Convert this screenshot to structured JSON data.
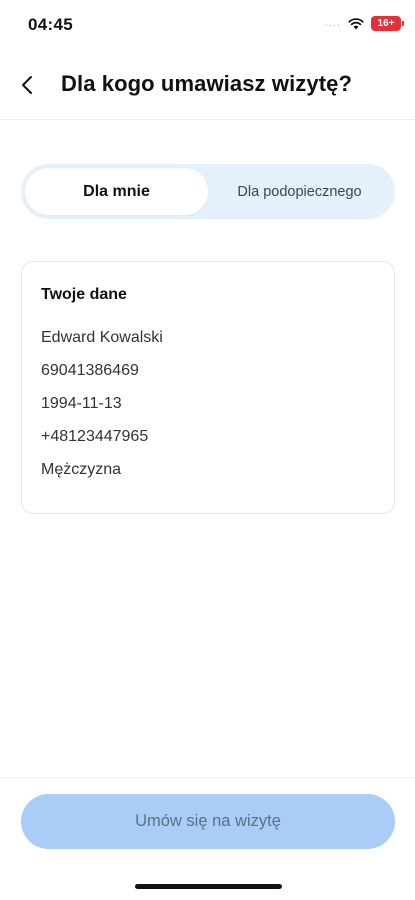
{
  "status_bar": {
    "time": "04:45",
    "signal": "....",
    "battery": "16+",
    "battery_color": "#e4303b"
  },
  "header": {
    "back_icon": "chevron-left-icon",
    "title": "Dla kogo umawiasz wizytę?"
  },
  "segments": {
    "selected": "Dla mnie",
    "options": [
      "Dla mnie",
      "Dla podopiecznego"
    ]
  },
  "card": {
    "title": "Twoje dane",
    "lines": [
      "Edward Kowalski",
      "69041386469",
      "1994-11-13",
      "+48123447965",
      "Mężczyzna"
    ]
  },
  "footer": {
    "button_label": "Umów się na wizytę",
    "button_color": "#a9cdf6"
  }
}
